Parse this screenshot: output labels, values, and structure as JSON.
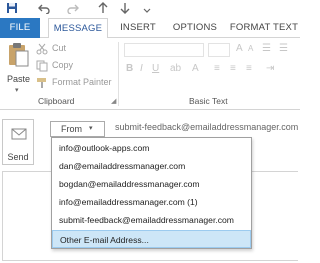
{
  "tabs": {
    "file": "FILE",
    "message": "MESSAGE",
    "insert": "INSERT",
    "options": "OPTIONS",
    "format_text": "FORMAT TEXT"
  },
  "clipboard": {
    "paste": "Paste",
    "cut": "Cut",
    "copy": "Copy",
    "format_painter": "Format Painter",
    "group_label": "Clipboard"
  },
  "basic_text": {
    "group_label": "Basic Text"
  },
  "compose": {
    "send": "Send",
    "from_label": "From",
    "from_value": "submit-feedback@emailaddressmanager.com"
  },
  "from_menu": [
    "info@outlook-apps.com",
    "dan@emailaddressmanager.com",
    "bogdan@emailaddressmanager.com",
    "info@emailaddressmanager.com (1)",
    "submit-feedback@emailaddressmanager.com",
    "Other E-mail Address..."
  ],
  "colors": {
    "file_tab": "#2b78c2",
    "accent": "#2b579a",
    "selected_item": "#cde6f7"
  },
  "icons": [
    "save-icon",
    "undo-icon",
    "redo-icon",
    "up-arrow-icon",
    "down-arrow-icon",
    "paste-icon",
    "cut-icon",
    "copy-icon",
    "format-painter-icon",
    "send-icon",
    "dropdown-arrow-icon"
  ]
}
